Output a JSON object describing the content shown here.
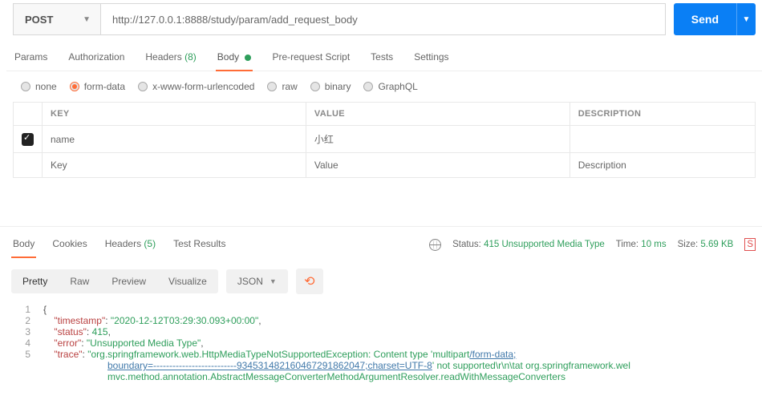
{
  "request": {
    "method": "POST",
    "url": "http://127.0.0.1:8888/study/param/add_request_body",
    "send_label": "Send"
  },
  "req_tabs": {
    "params": "Params",
    "auth": "Authorization",
    "headers": "Headers",
    "headers_count": "(8)",
    "body": "Body",
    "prerequest": "Pre-request Script",
    "tests": "Tests",
    "settings": "Settings"
  },
  "body_types": {
    "none": "none",
    "formdata": "form-data",
    "urlencoded": "x-www-form-urlencoded",
    "raw": "raw",
    "binary": "binary",
    "graphql": "GraphQL"
  },
  "kv": {
    "key_header": "KEY",
    "value_header": "VALUE",
    "desc_header": "DESCRIPTION",
    "rows": [
      {
        "key": "name",
        "value": "小红"
      }
    ],
    "key_placeholder": "Key",
    "value_placeholder": "Value",
    "desc_placeholder": "Description"
  },
  "resp_tabs": {
    "body": "Body",
    "cookies": "Cookies",
    "headers": "Headers",
    "headers_count": "(5)",
    "tests": "Test Results"
  },
  "resp_meta": {
    "status_label": "Status:",
    "status_value": "415 Unsupported Media Type",
    "time_label": "Time:",
    "time_value": "10 ms",
    "size_label": "Size:",
    "size_value": "5.69 KB"
  },
  "view": {
    "pretty": "Pretty",
    "raw": "Raw",
    "preview": "Preview",
    "visualize": "Visualize",
    "format": "JSON"
  },
  "json_body": {
    "timestamp_key": "\"timestamp\"",
    "timestamp_val": "\"2020-12-12T03:29:30.093+00:00\"",
    "status_key": "\"status\"",
    "status_val": "415",
    "error_key": "\"error\"",
    "error_val": "\"Unsupported Media Type\"",
    "trace_key": "\"trace\"",
    "trace_val_prefix": "\"org.springframework.web.HttpMediaTypeNotSupportedException: Content type 'multipart",
    "trace_val_link1": "/form-data;",
    "trace_cont_link": "boundary=--------------------------934531482160467291862047;charset=UTF-8",
    "trace_cont_mid": "' not supported\\r\\n\\tat org.springframework.wel",
    "trace_line3": "mvc.method.annotation.AbstractMessageConverterMethodArgumentResolver.readWithMessageConverters"
  }
}
